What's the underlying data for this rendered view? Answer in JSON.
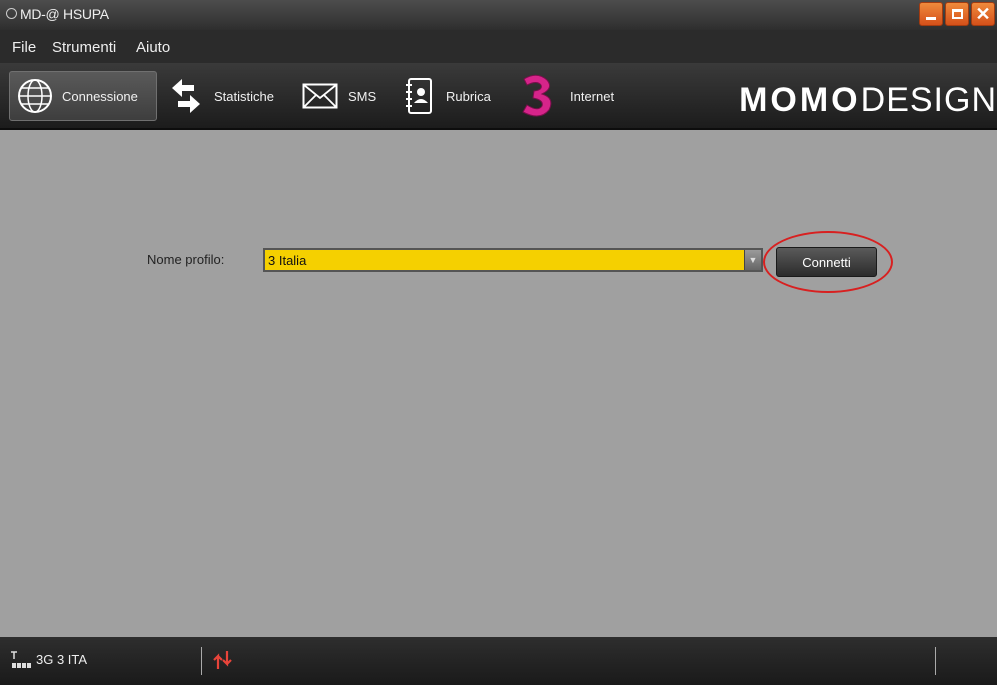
{
  "window": {
    "title": "MD-@ HSUPA",
    "controls": {
      "minimize": "",
      "maximize": "",
      "close": "✕"
    }
  },
  "menubar": {
    "items": [
      {
        "label": "File"
      },
      {
        "label": "Strumenti"
      },
      {
        "label": "Aiuto"
      }
    ]
  },
  "toolbar": {
    "items": [
      {
        "label": "Connessione",
        "icon": "globe-icon",
        "active": true
      },
      {
        "label": "Statistiche",
        "icon": "transfer-arrows-icon"
      },
      {
        "label": "SMS",
        "icon": "envelope-icon"
      },
      {
        "label": "Rubrica",
        "icon": "address-book-icon"
      },
      {
        "label": "Internet",
        "icon": "three-logo-icon"
      }
    ],
    "brand": {
      "bold": "MOMO",
      "light": "DESIGN"
    }
  },
  "main": {
    "profile_label": "Nome profilo:",
    "profile_value": "3 Italia",
    "connect_label": "Connetti"
  },
  "statusbar": {
    "network": "3G  3 ITA"
  },
  "colors": {
    "select_bg": "#f5d000",
    "highlight": "#d82020",
    "accent_orange": "#e06a28",
    "three_logo": "#d6248a"
  }
}
